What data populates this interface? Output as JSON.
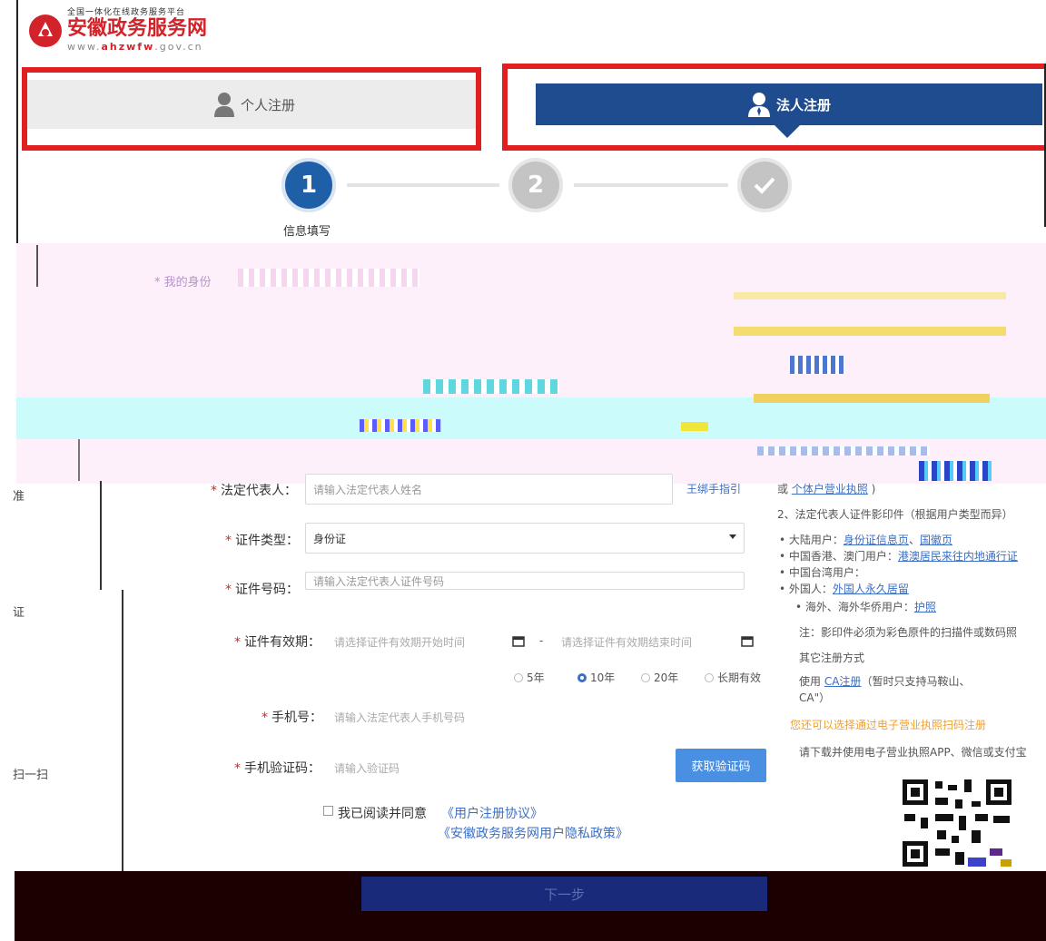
{
  "header": {
    "subtitle": "全国一体化在线政务服务平台",
    "title": "安徽政务服务网",
    "url_prefix": "www.",
    "url_bold": "ahzwfw",
    "url_suffix": ".gov.cn"
  },
  "tabs": {
    "personal": "个人注册",
    "legal": "法人注册"
  },
  "steps": {
    "step1_num": "1",
    "step2_num": "2",
    "step1_label": "信息填写"
  },
  "band": {
    "identity_label": "* 我的身份"
  },
  "form": {
    "legal_rep_label": "法定代表人：",
    "legal_rep_placeholder": "请输入法定代表人姓名",
    "help_link": "王绑手指引",
    "cert_type_label": "证件类型：",
    "cert_type_value": "身份证",
    "cert_no_label": "证件号码：",
    "cert_no_placeholder": "请输入法定代表人证件号码",
    "validity_label": "证件有效期：",
    "validity_start_ph": "请选择证件有效期开始时间",
    "validity_dash": "-",
    "validity_end_ph": "请选择证件有效期结束时间",
    "opt_5": "5年",
    "opt_10": "10年",
    "opt_20": "20年",
    "opt_long": "长期有效",
    "phone_label": "手机号：",
    "phone_placeholder": "请输入法定代表人手机号码",
    "code_label": "手机验证码：",
    "code_placeholder": "请输入验证码",
    "get_code": "获取验证码",
    "agree": "我已阅读并同意",
    "agreement_link": "《用户注册协议》",
    "privacy_link": "《安徽政务服务网用户隐私政策》",
    "next": "下一步"
  },
  "side": {
    "s1": "准",
    "s2": "证",
    "s3": "扫一扫"
  },
  "right_panel": {
    "r_biz_link": "个体户营业执照",
    "r2": "2、法定代表人证件影印件（根据用户类型而异）",
    "r3_pre": "大陆用户：",
    "r3_link1": "身份证信息页",
    "r3_link2": "国徽页",
    "r4_pre": "中国香港、澳门用户：",
    "r4_link": "港澳居民来往内地通行证",
    "r5_pre": "中国台湾用户：",
    "r6_pre": "外国人：",
    "r6_link": "外国人永久居留",
    "r7_pre": "海外、海外华侨用户：",
    "r7_link": "护照",
    "r8": "注：影印件必须为彩色原件的扫描件或数码照",
    "r9": "其它注册方式",
    "r10_pre": "使用",
    "r10_link": "CA注册",
    "r10_post": "（暂时只支持马鞍山、",
    "r11": "CA\"）",
    "r12": "您还可以选择通过电子营业执照扫码注册",
    "r13": "请下载并使用电子营业执照APP、微信或支付宝"
  },
  "colors": {
    "brand_red": "#d2232a",
    "tab_blue": "#1f4b8f",
    "step_active": "#1f5fa8",
    "link_blue": "#3c6fc4"
  }
}
